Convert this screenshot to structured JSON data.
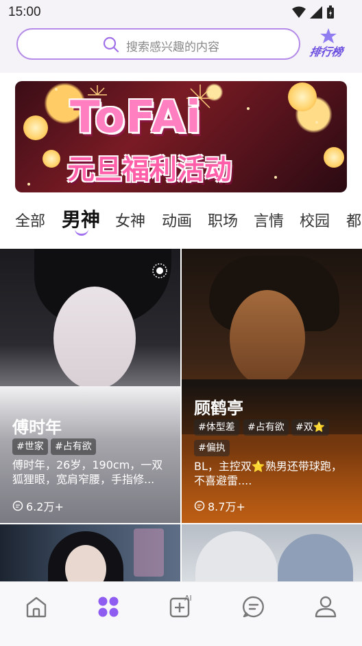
{
  "status_bar": {
    "time": "15:00"
  },
  "header": {
    "search_placeholder": "搜索感兴趣的内容",
    "rank_label": "排行榜"
  },
  "banner": {
    "title": "ToFAi",
    "subtitle": "元旦福利活动"
  },
  "tabs": [
    {
      "label": "全部"
    },
    {
      "label": "男神",
      "active": true
    },
    {
      "label": "女神"
    },
    {
      "label": "动画"
    },
    {
      "label": "职场"
    },
    {
      "label": "言情"
    },
    {
      "label": "校园"
    },
    {
      "label": "都"
    }
  ],
  "cards": [
    {
      "name": "傅时年",
      "tags": [
        "#世家",
        "#占有欲"
      ],
      "description": "傅时年，26岁，190cm，一双狐狸眼，宽肩窄腰，手指修...",
      "count": "6.2万+"
    },
    {
      "name": "顾鹤亭",
      "tags": [
        "#体型差",
        "#占有欲",
        "#双⭐",
        "#偏执"
      ],
      "description": "BL，主控双⭐熟男还带球跑，不喜避雷....",
      "count": "8.7万+"
    }
  ],
  "bottom_nav": [
    {
      "icon": "home-icon"
    },
    {
      "icon": "discover-grid-icon",
      "active": true
    },
    {
      "icon": "ai-create-icon",
      "badge": "AI"
    },
    {
      "icon": "message-icon"
    },
    {
      "icon": "profile-icon"
    }
  ],
  "colors": {
    "accent": "#a06ff0",
    "search_border": "#b48be8",
    "nav_active": "#8e5cf0"
  }
}
